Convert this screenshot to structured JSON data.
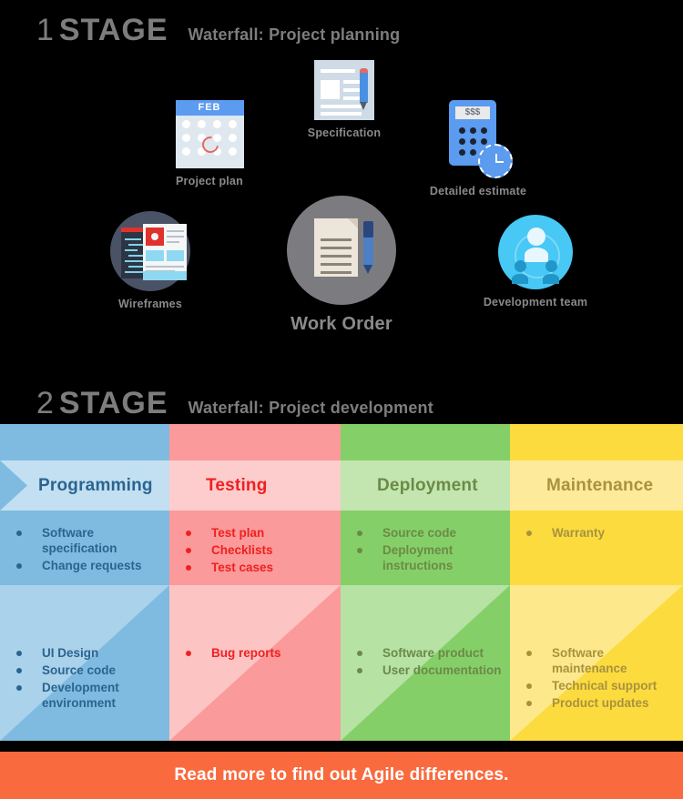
{
  "stage1": {
    "number": "1",
    "word": "STAGE",
    "subtitle": "Waterfall: Project planning",
    "icons": [
      {
        "name": "project-plan",
        "label": "Project plan",
        "badge": "FEB"
      },
      {
        "name": "specification",
        "label": "Specification"
      },
      {
        "name": "detailed-estimate",
        "label": "Detailed estimate",
        "screen": "$$$"
      },
      {
        "name": "wireframes",
        "label": "Wireframes"
      },
      {
        "name": "work-order",
        "label": "Work Order"
      },
      {
        "name": "development-team",
        "label": "Development team"
      }
    ]
  },
  "stage2": {
    "number": "2",
    "word": "STAGE",
    "subtitle": "Waterfall: Project development",
    "columns": [
      {
        "title": "Programming",
        "color_dark": "#7fbbe0",
        "color_light": "#c3dff2",
        "text_color": "#2a6490",
        "upper_items": [
          "Software specification",
          "Change requests"
        ],
        "lower_items": [
          "UI Design",
          "Source code",
          "Development environment"
        ]
      },
      {
        "title": "Testing",
        "color_dark": "#fb9a9a",
        "color_light": "#fdcdcd",
        "text_color": "#f02020",
        "upper_items": [
          "Test plan",
          "Checklists",
          "Test cases"
        ],
        "lower_items": [
          "Bug reports"
        ]
      },
      {
        "title": "Deployment",
        "color_dark": "#85cf68",
        "color_light": "#c3e6b0",
        "text_color": "#6b8a47",
        "upper_items": [
          "Source code",
          "Deployment instructions"
        ],
        "lower_items": [
          "Software product",
          "User documentation"
        ]
      },
      {
        "title": "Maintenance",
        "color_dark": "#fcdb3e",
        "color_light": "#fdeb9b",
        "text_color": "#a8923f",
        "upper_items": [
          "Warranty"
        ],
        "lower_items": [
          "Software maintenance",
          "Technical support",
          "Product updates"
        ]
      }
    ]
  },
  "footer": {
    "text": "Read more to find out Agile differences.",
    "color": "#f96a3e"
  }
}
